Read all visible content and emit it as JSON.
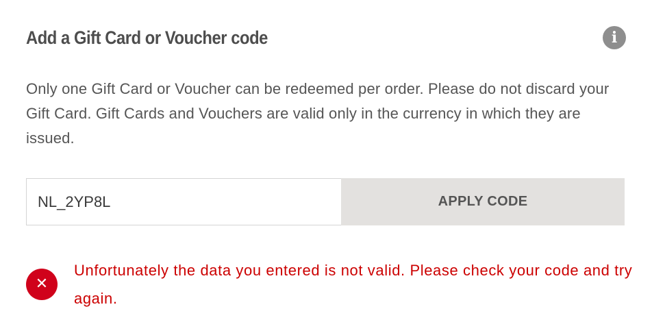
{
  "gift_card": {
    "title": "Add a Gift Card or Voucher code",
    "info_icon_glyph": "i",
    "info_icon": "info-icon",
    "description": "Only one Gift Card or Voucher can be redeemed per order. Please do not discard your Gift Card. Gift Cards and Vouchers are valid only in the currency in which they are issued.",
    "code_input": {
      "value": "NL_2YP8L",
      "placeholder": ""
    },
    "apply_label": "APPLY CODE",
    "error": {
      "icon": "error-x-icon",
      "icon_glyph": "✕",
      "message": "Unfortunately the data you entered is not valid. Please check your code and try again."
    },
    "colors": {
      "error": "#cc0000",
      "error_icon_bg": "#d0021b",
      "button_bg": "#e3e1df",
      "info_icon_bg": "#8e8e8e",
      "text": "#555555"
    }
  }
}
